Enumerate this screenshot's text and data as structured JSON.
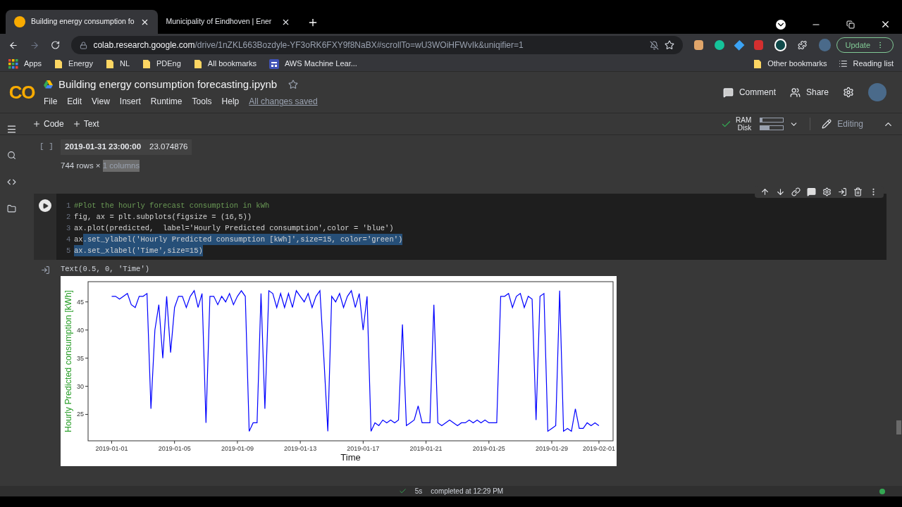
{
  "browser": {
    "tabs": [
      {
        "title": "Building energy consumption fo",
        "selected": true
      },
      {
        "title": "Municipality of Eindhoven | Ener",
        "selected": false
      }
    ],
    "address": {
      "host": "colab.research.google.com",
      "path": "/drive/1nZKL663Bozdyle-YF3oRK6FXY9f8NaBX#scrollTo=wU3WOiHFWvIk&uniqifier=1"
    },
    "update_button": "Update",
    "bookmarks": [
      {
        "label": "Apps",
        "kind": "apps"
      },
      {
        "label": "Energy",
        "kind": "folder"
      },
      {
        "label": "NL",
        "kind": "folder"
      },
      {
        "label": "PDEng",
        "kind": "folder"
      },
      {
        "label": "All bookmarks",
        "kind": "folder"
      },
      {
        "label": "AWS Machine Lear...",
        "kind": "page"
      }
    ],
    "other_bookmarks": "Other bookmarks",
    "reading_list": "Reading list"
  },
  "notebook": {
    "logo": "CO",
    "title": "Building energy consumption forecasting.ipynb",
    "menu": [
      "File",
      "Edit",
      "View",
      "Insert",
      "Runtime",
      "Tools",
      "Help"
    ],
    "save_status": "All changes saved",
    "comment": "Comment",
    "share": "Share"
  },
  "toolbar": {
    "add_code": "Code",
    "add_text": "Text",
    "ram": {
      "label": "RAM",
      "level": 0.1
    },
    "disk": {
      "label": "Disk",
      "level": 0.4
    },
    "mode": "Editing"
  },
  "output_cell": {
    "bracket": "[ ]",
    "row": {
      "index": "2019-01-31 23:00:00",
      "value": "23.074876"
    },
    "summary": [
      {
        "text": "744 rows × ",
        "selected": false
      },
      {
        "text": "1 columns",
        "selected": true
      }
    ]
  },
  "code_cell": {
    "lines": [
      {
        "number": "1",
        "kind": "comment",
        "segments": [
          {
            "text": "#Plot the hourly forecast consumption in kWh",
            "selected": false
          }
        ]
      },
      {
        "number": "2",
        "kind": "code",
        "segments": [
          {
            "text": "fig, ax = plt.subplots(figsize = (16,5))",
            "selected": false
          }
        ]
      },
      {
        "number": "3",
        "kind": "code",
        "segments": [
          {
            "text": "ax.plot(predicted,  label='Hourly Predicted consumption',color = 'blue')",
            "selected": false
          }
        ]
      },
      {
        "number": "4",
        "kind": "code",
        "segments": [
          {
            "text": "ax",
            "selected": false
          },
          {
            "text": ".set_ylabel('Hourly Predicted consumption [kWh]',size=15, color='green')",
            "selected": true
          }
        ]
      },
      {
        "number": "5",
        "kind": "code",
        "segments": [
          {
            "text": "ax.set_xlabel('Time',size=15)",
            "selected": true
          }
        ]
      }
    ],
    "output_text": "Text(0.5, 0, 'Time')",
    "chart_data": {
      "type": "line",
      "xlabel": "Time",
      "ylabel": "Hourly Predicted consumption [kWh]",
      "ylim": [
        20.3,
        48.6
      ],
      "categories": [
        "2019-01-01",
        null,
        null,
        null,
        null,
        null,
        null,
        null,
        null,
        null,
        null,
        null,
        null,
        null,
        null,
        null,
        "2019-01-05",
        null,
        null,
        null,
        null,
        null,
        null,
        null,
        null,
        null,
        null,
        null,
        null,
        null,
        null,
        null,
        "2019-01-09",
        null,
        null,
        null,
        null,
        null,
        null,
        null,
        null,
        null,
        null,
        null,
        null,
        null,
        null,
        null,
        "2019-01-13",
        null,
        null,
        null,
        null,
        null,
        null,
        null,
        null,
        null,
        null,
        null,
        null,
        null,
        null,
        null,
        "2019-01-17",
        null,
        null,
        null,
        null,
        null,
        null,
        null,
        null,
        null,
        null,
        null,
        null,
        null,
        null,
        null,
        "2019-01-21",
        null,
        null,
        null,
        null,
        null,
        null,
        null,
        null,
        null,
        null,
        null,
        null,
        null,
        null,
        null,
        "2019-01-25",
        null,
        null,
        null,
        null,
        null,
        null,
        null,
        null,
        null,
        null,
        null,
        null,
        null,
        null,
        null,
        "2019-01-29",
        null,
        null,
        null,
        null,
        null,
        null,
        null,
        null,
        null,
        null,
        null,
        "2019-02-01"
      ],
      "yticks": [
        25,
        30,
        35,
        40,
        45
      ],
      "series": [
        {
          "color": "#0000ff",
          "values": [
            46,
            46,
            45.5,
            46,
            46.5,
            44.5,
            44,
            46,
            46,
            46.5,
            26,
            40,
            44.5,
            35,
            46,
            36,
            44,
            46,
            46,
            44,
            46,
            47,
            44,
            46.5,
            23.5,
            46,
            46,
            44.5,
            46,
            45,
            46.5,
            44.5,
            46,
            47,
            46,
            22,
            23.5,
            23.5,
            46.5,
            26,
            47,
            46.5,
            44,
            46.5,
            44,
            46.5,
            44,
            47,
            46,
            45,
            46.5,
            44,
            46,
            47,
            35,
            22,
            46,
            45,
            46.5,
            44,
            46,
            47,
            44,
            46.5,
            40,
            46,
            22,
            23.5,
            23,
            24,
            23.5,
            24,
            23.5,
            24,
            41,
            23,
            23.5,
            24,
            26.5,
            23.5,
            23.5,
            23.5,
            44.5,
            23.5,
            23,
            23.5,
            24,
            23.5,
            23,
            23.5,
            23.5,
            24,
            23.5,
            24,
            23.5,
            24,
            23.5,
            23.5,
            23.5,
            46,
            46,
            46.5,
            44,
            46,
            46.5,
            44,
            46,
            45.5,
            24,
            46,
            46.5,
            22,
            22.5,
            23,
            47,
            22,
            22.5,
            22,
            26,
            22.5,
            22.5,
            23.5,
            23,
            23.5,
            23
          ]
        }
      ]
    }
  },
  "status": {
    "duration": "5s",
    "text": "completed at 12:29 PM"
  }
}
